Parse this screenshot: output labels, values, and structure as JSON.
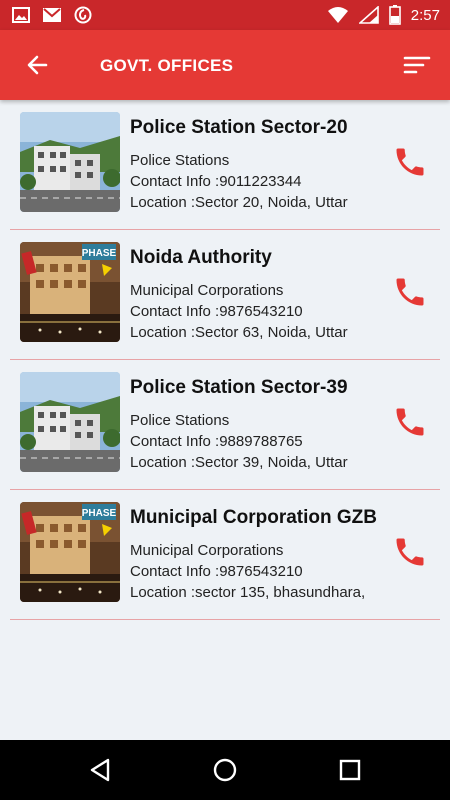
{
  "status_bar": {
    "time": "2:57"
  },
  "app_bar": {
    "title": "GOVT. OFFICES"
  },
  "offices": [
    {
      "name": "Police Station Sector-20",
      "category": "Police Stations",
      "contact": "Contact Info :9011223344",
      "location": "Location :Sector 20, Noida, Uttar",
      "image": "police-building"
    },
    {
      "name": "Noida Authority",
      "category": "Municipal Corporations",
      "contact": "Contact Info :9876543210",
      "location": "Location :Sector 63, Noida, Uttar",
      "image": "phase-building"
    },
    {
      "name": "Police Station Sector-39",
      "category": "Police Stations",
      "contact": "Contact Info :9889788765",
      "location": "Location :Sector 39, Noida, Uttar",
      "image": "police-building"
    },
    {
      "name": "Municipal Corporation GZB",
      "category": "Municipal Corporations",
      "contact": "Contact Info :9876543210",
      "location": "Location :sector 135, bhasundhara,",
      "image": "phase-building"
    }
  ],
  "colors": {
    "status_bar": "#c9272a",
    "app_bar": "#e53935",
    "call_icon": "#e53935",
    "divider": "#e7a3a6",
    "background": "#eef2f6"
  }
}
